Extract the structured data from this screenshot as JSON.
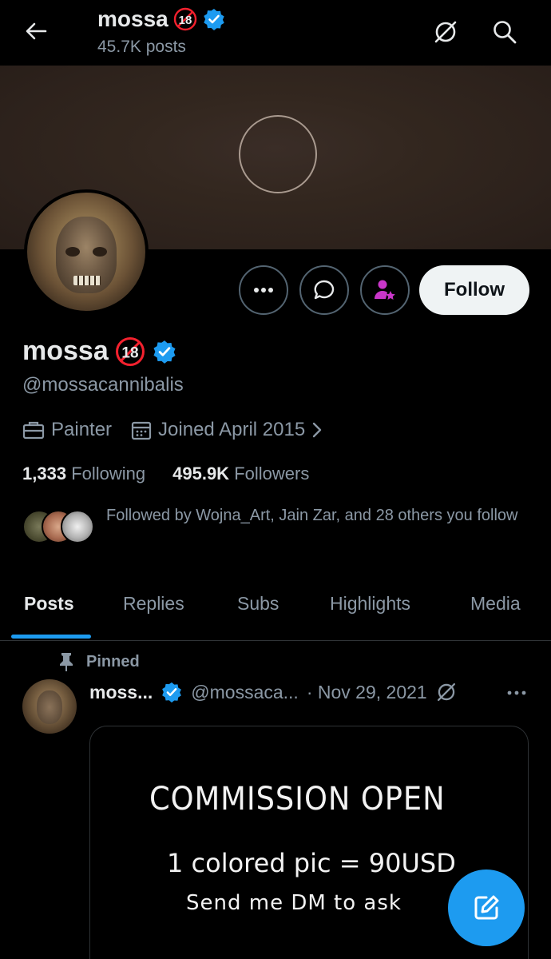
{
  "header": {
    "name": "mossa",
    "posts_count": "45.7K posts"
  },
  "profile": {
    "display_name": "mossa",
    "handle": "@mossacannibalis",
    "profession": "Painter",
    "joined": "Joined April 2015",
    "following_count": "1,333",
    "following_label": "Following",
    "followers_count": "495.9K",
    "followers_label": "Followers",
    "followed_by": "Followed by Wojna_Art, Jain Zar, and 28 others you follow",
    "follow_button": "Follow"
  },
  "tabs": [
    {
      "label": "Posts",
      "active": true
    },
    {
      "label": "Replies"
    },
    {
      "label": "Subs"
    },
    {
      "label": "Highlights"
    },
    {
      "label": "Media"
    }
  ],
  "pinned_post": {
    "pinned_label": "Pinned",
    "name": "moss...",
    "handle": "@mossaca...",
    "date": "· Nov 29, 2021",
    "image_text": {
      "line1": "COMMISSION OPEN",
      "line2": "1 colored pic = 90USD",
      "line3": "Send me DM to ask"
    }
  },
  "colors": {
    "accent": "#1d9bf0",
    "background": "#000000",
    "muted_text": "#8b98a5",
    "primary_text": "#e7e9ea",
    "subs_icon": "#c936c9"
  },
  "icons": [
    "back-arrow-icon",
    "grok-icon",
    "search-icon",
    "verified-badge-icon",
    "adult-content-18-icon",
    "more-icon",
    "message-icon",
    "subscribe-icon",
    "briefcase-icon",
    "calendar-icon",
    "chevron-right-icon",
    "pin-icon",
    "compose-icon"
  ]
}
